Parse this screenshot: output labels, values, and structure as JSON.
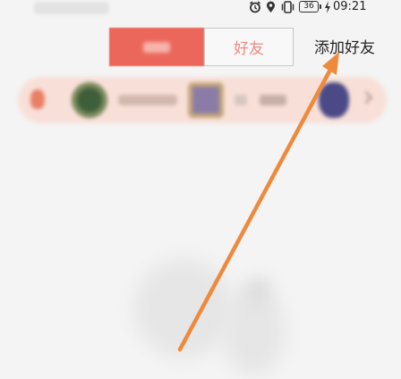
{
  "status_bar": {
    "time": "09:21",
    "battery": "36",
    "icons": [
      "alarm-icon",
      "location-icon",
      "vibrate-icon",
      "battery-icon",
      "charging-icon"
    ]
  },
  "tabs": [
    {
      "label": "",
      "active": true
    },
    {
      "label": "好友",
      "active": false
    }
  ],
  "add_friend": "添加好友",
  "colors": {
    "accent": "#ec675b",
    "accent_text": "#ef8a80",
    "arrow": "#ee8a3c",
    "strip": "#f8e0d8"
  }
}
